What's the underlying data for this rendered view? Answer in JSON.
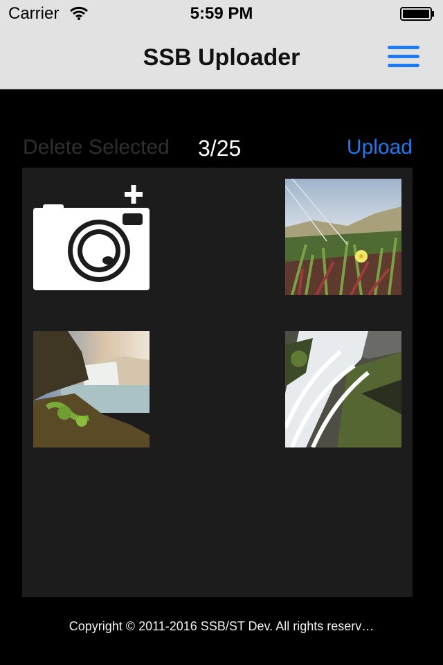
{
  "status": {
    "carrier": "Carrier",
    "time": "5:59 PM"
  },
  "nav": {
    "title": "SSB Uploader",
    "menu_icon": "hamburger-menu-icon"
  },
  "toolbar": {
    "delete_label": "Delete Selected",
    "counter": "3/25",
    "upload_label": "Upload"
  },
  "grid": {
    "add_photo_icon": "camera-plus-icon",
    "photos": [
      {
        "name": "photo-flowers-dunes"
      },
      {
        "name": "photo-waterfall-cliff"
      },
      {
        "name": "photo-waterfall-rocks"
      }
    ]
  },
  "footer": {
    "copyright": "Copyright © 2011-2016 SSB/ST Dev. All rights reserv…"
  },
  "colors": {
    "accent": "#1e7bf0",
    "bar": "#e2e2e2",
    "background": "#000000",
    "panel": "#1c1c1c"
  }
}
